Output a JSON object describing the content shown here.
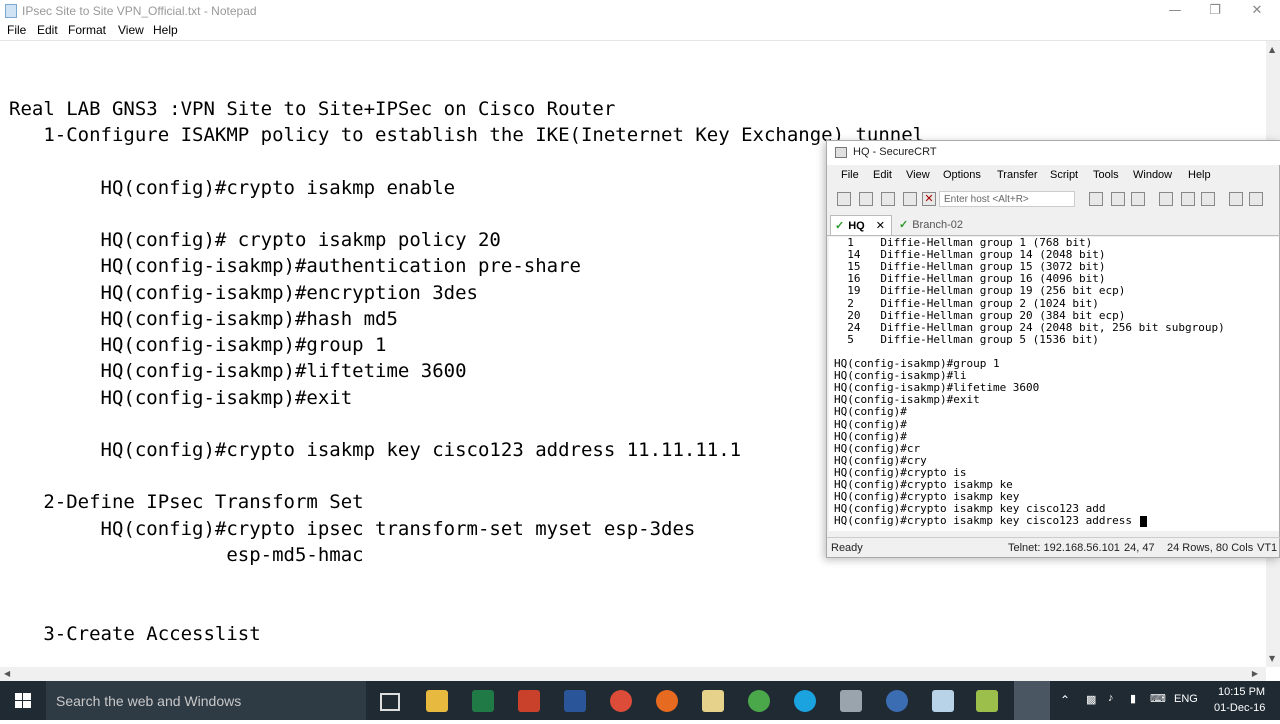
{
  "notepad": {
    "title": "IPsec Site to Site VPN_Official.txt - Notepad",
    "menu": [
      "File",
      "Edit",
      "Format",
      "View",
      "Help"
    ],
    "lines": [
      "Real LAB GNS3 :VPN Site to Site+IPSec on Cisco Router",
      "   1-Configure ISAKMP policy to establish the IKE(Ineternet Key Exchange) tunnel",
      "        HQ(config)#crypto isakmp enable",
      "        HQ(config)# crypto isakmp policy 20",
      "        HQ(config-isakmp)#authentication pre-share",
      "        HQ(config-isakmp)#encryption 3des",
      "        HQ(config-isakmp)#hash md5",
      "        HQ(config-isakmp)#group 1",
      "        HQ(config-isakmp)#liftetime 3600",
      "        HQ(config-isakmp)#exit",
      "        HQ(config)#crypto isakmp key cisco123 address 11.11.11.1",
      "   2-Define IPsec Transform Set",
      "        HQ(config)#crypto ipsec transform-set myset esp-3des",
      "                   esp-md5-hmac",
      "   3-Create Accesslist"
    ]
  },
  "securecrt": {
    "title": "HQ - SecureCRT",
    "menu": [
      "File",
      "Edit",
      "View",
      "Options",
      "Transfer",
      "Script",
      "Tools",
      "Window",
      "Help"
    ],
    "host_placeholder": "Enter host <Alt+R>",
    "tabs": [
      {
        "label": "HQ",
        "active": true
      },
      {
        "label": "Branch-02",
        "active": false
      }
    ],
    "terminal_lines": [
      "  1    Diffie-Hellman group 1 (768 bit)",
      "  14   Diffie-Hellman group 14 (2048 bit)",
      "  15   Diffie-Hellman group 15 (3072 bit)",
      "  16   Diffie-Hellman group 16 (4096 bit)",
      "  19   Diffie-Hellman group 19 (256 bit ecp)",
      "  2    Diffie-Hellman group 2 (1024 bit)",
      "  20   Diffie-Hellman group 20 (384 bit ecp)",
      "  24   Diffie-Hellman group 24 (2048 bit, 256 bit subgroup)",
      "  5    Diffie-Hellman group 5 (1536 bit)",
      "",
      "HQ(config-isakmp)#group 1",
      "HQ(config-isakmp)#li",
      "HQ(config-isakmp)#lifetime 3600",
      "HQ(config-isakmp)#exit",
      "HQ(config)#",
      "HQ(config)#",
      "HQ(config)#",
      "HQ(config)#cr",
      "HQ(config)#cry",
      "HQ(config)#crypto is",
      "HQ(config)#crypto isakmp ke",
      "HQ(config)#crypto isakmp key",
      "HQ(config)#crypto isakmp key cisco123 add",
      "HQ(config)#crypto isakmp key cisco123 address "
    ],
    "status": {
      "state": "Ready",
      "connection": "Telnet: 192.168.56.101",
      "cursor": "24,  47",
      "size": "24 Rows, 80 Cols",
      "term": "VT1"
    }
  },
  "taskbar": {
    "search_placeholder": "Search the web and Windows",
    "language": "ENG",
    "time": "10:15 PM",
    "date": "01-Dec-16"
  }
}
